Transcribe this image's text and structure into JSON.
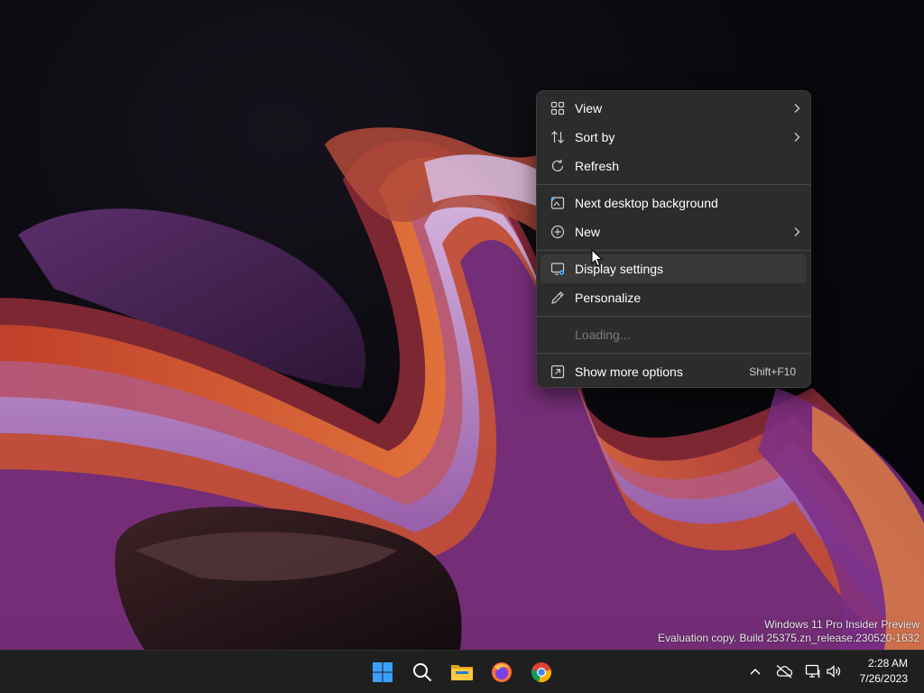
{
  "watermark": {
    "line1": "Windows 11 Pro Insider Preview",
    "line2": "Evaluation copy. Build 25375.zn_release.230520-1632"
  },
  "context_menu": {
    "items": [
      {
        "label": "View",
        "icon": "grid-view-icon",
        "submenu": true
      },
      {
        "label": "Sort by",
        "icon": "sort-arrows-icon",
        "submenu": true
      },
      {
        "label": "Refresh",
        "icon": "refresh-icon",
        "submenu": false
      },
      {
        "label": "Next desktop background",
        "icon": "next-background-icon",
        "submenu": false
      },
      {
        "label": "New",
        "icon": "plus-circle-icon",
        "submenu": true
      },
      {
        "label": "Display settings",
        "icon": "display-settings-icon",
        "submenu": false,
        "hovered": true
      },
      {
        "label": "Personalize",
        "icon": "pen-icon",
        "submenu": false
      },
      {
        "label": "Loading...",
        "icon": "",
        "submenu": false,
        "disabled": true
      },
      {
        "label": "Show more options",
        "icon": "show-more-icon",
        "submenu": false,
        "shortcut": "Shift+F10"
      }
    ]
  },
  "taskbar": {
    "apps": [
      {
        "name": "Start",
        "icon": "windows-start-icon"
      },
      {
        "name": "Search",
        "icon": "search-icon"
      },
      {
        "name": "File Explorer",
        "icon": "file-explorer-icon"
      },
      {
        "name": "Firefox",
        "icon": "firefox-icon"
      },
      {
        "name": "Chrome",
        "icon": "chrome-icon"
      }
    ],
    "tray": [
      "chevron-up-icon",
      "onedrive-offline-icon",
      "network-icon",
      "volume-icon"
    ],
    "clock": {
      "time": "2:28 AM",
      "date": "7/26/2023"
    }
  },
  "colors": {
    "menu_bg": "#2c2c2c",
    "taskbar_bg": "#1f1f1f",
    "windows_blue": "#1e90ff"
  }
}
